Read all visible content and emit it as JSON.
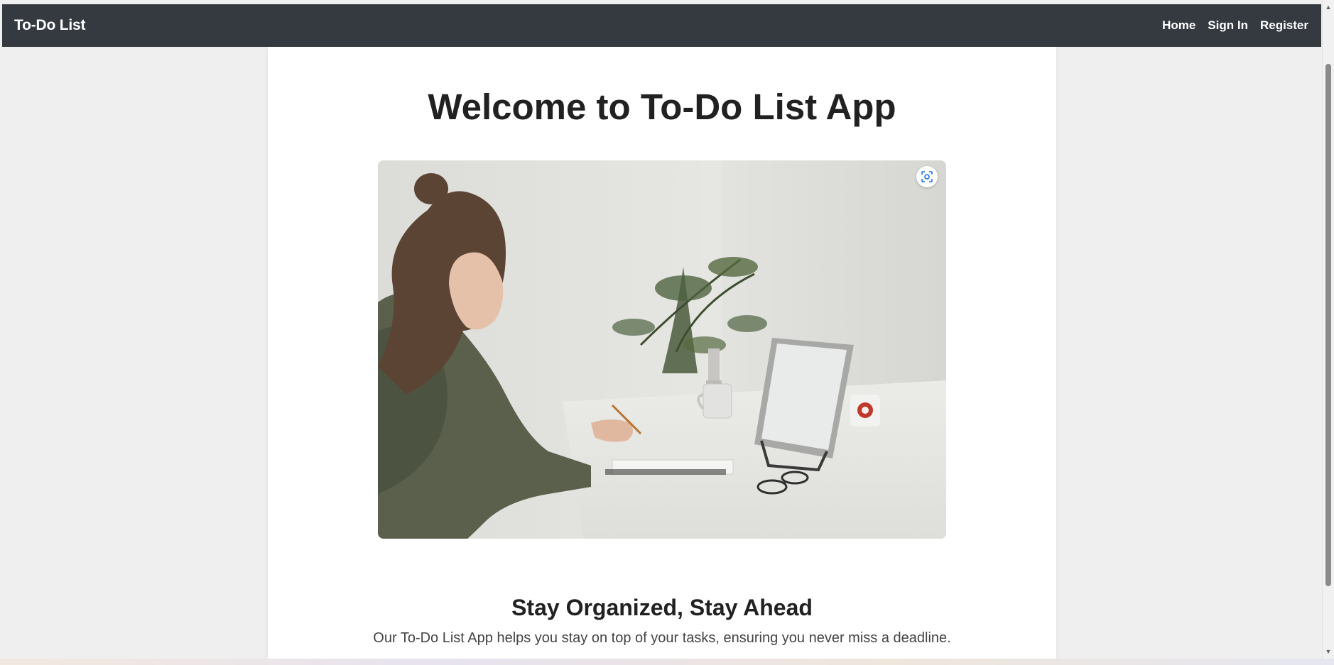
{
  "navbar": {
    "brand": "To-Do List",
    "links": [
      "Home",
      "Sign In",
      "Register"
    ],
    "background": "#343a40"
  },
  "hero": {
    "title": "Welcome to To-Do List App",
    "image_icon": "visual-search-icon"
  },
  "section": {
    "title": "Stay Organized, Stay Ahead",
    "text": "Our To-Do List App helps you stay on top of your tasks, ensuring you never miss a deadline."
  },
  "colors": {
    "page_background": "#efefef",
    "content_background": "#ffffff",
    "heading": "#212121"
  }
}
